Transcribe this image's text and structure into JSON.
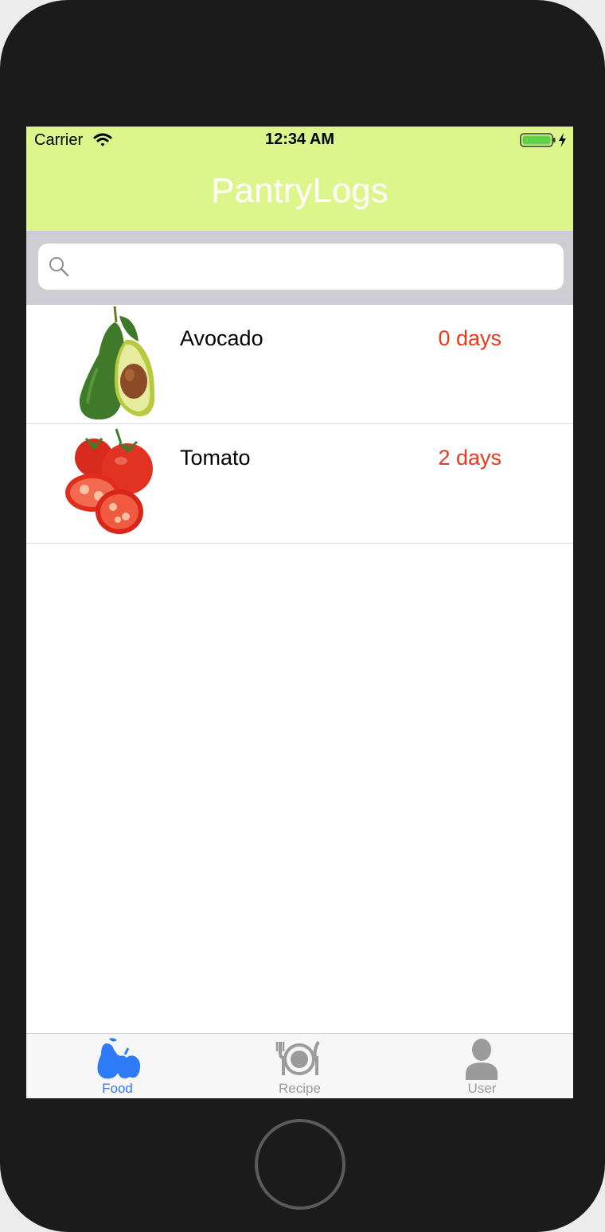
{
  "status_bar": {
    "carrier": "Carrier",
    "time": "12:34 AM"
  },
  "nav": {
    "title": "PantryLogs"
  },
  "search": {
    "value": "",
    "placeholder": ""
  },
  "food_items": [
    {
      "name": "Avocado",
      "days": "0 days",
      "icon": "avocado-image"
    },
    {
      "name": "Tomato",
      "days": "2 days",
      "icon": "tomato-image"
    }
  ],
  "tabs": [
    {
      "label": "Food",
      "icon": "fruit-icon",
      "active": true
    },
    {
      "label": "Recipe",
      "icon": "plate-cutlery-icon",
      "active": false
    },
    {
      "label": "User",
      "icon": "person-icon",
      "active": false
    }
  ],
  "colors": {
    "header_bg": "#dcf68c",
    "nav_title": "#ffffff",
    "days_text": "#e8391c",
    "tab_active": "#2f7af7",
    "tab_inactive": "#9b9b9b",
    "search_bar_bg": "#cdcdd3",
    "battery_fill": "#5fd048"
  }
}
